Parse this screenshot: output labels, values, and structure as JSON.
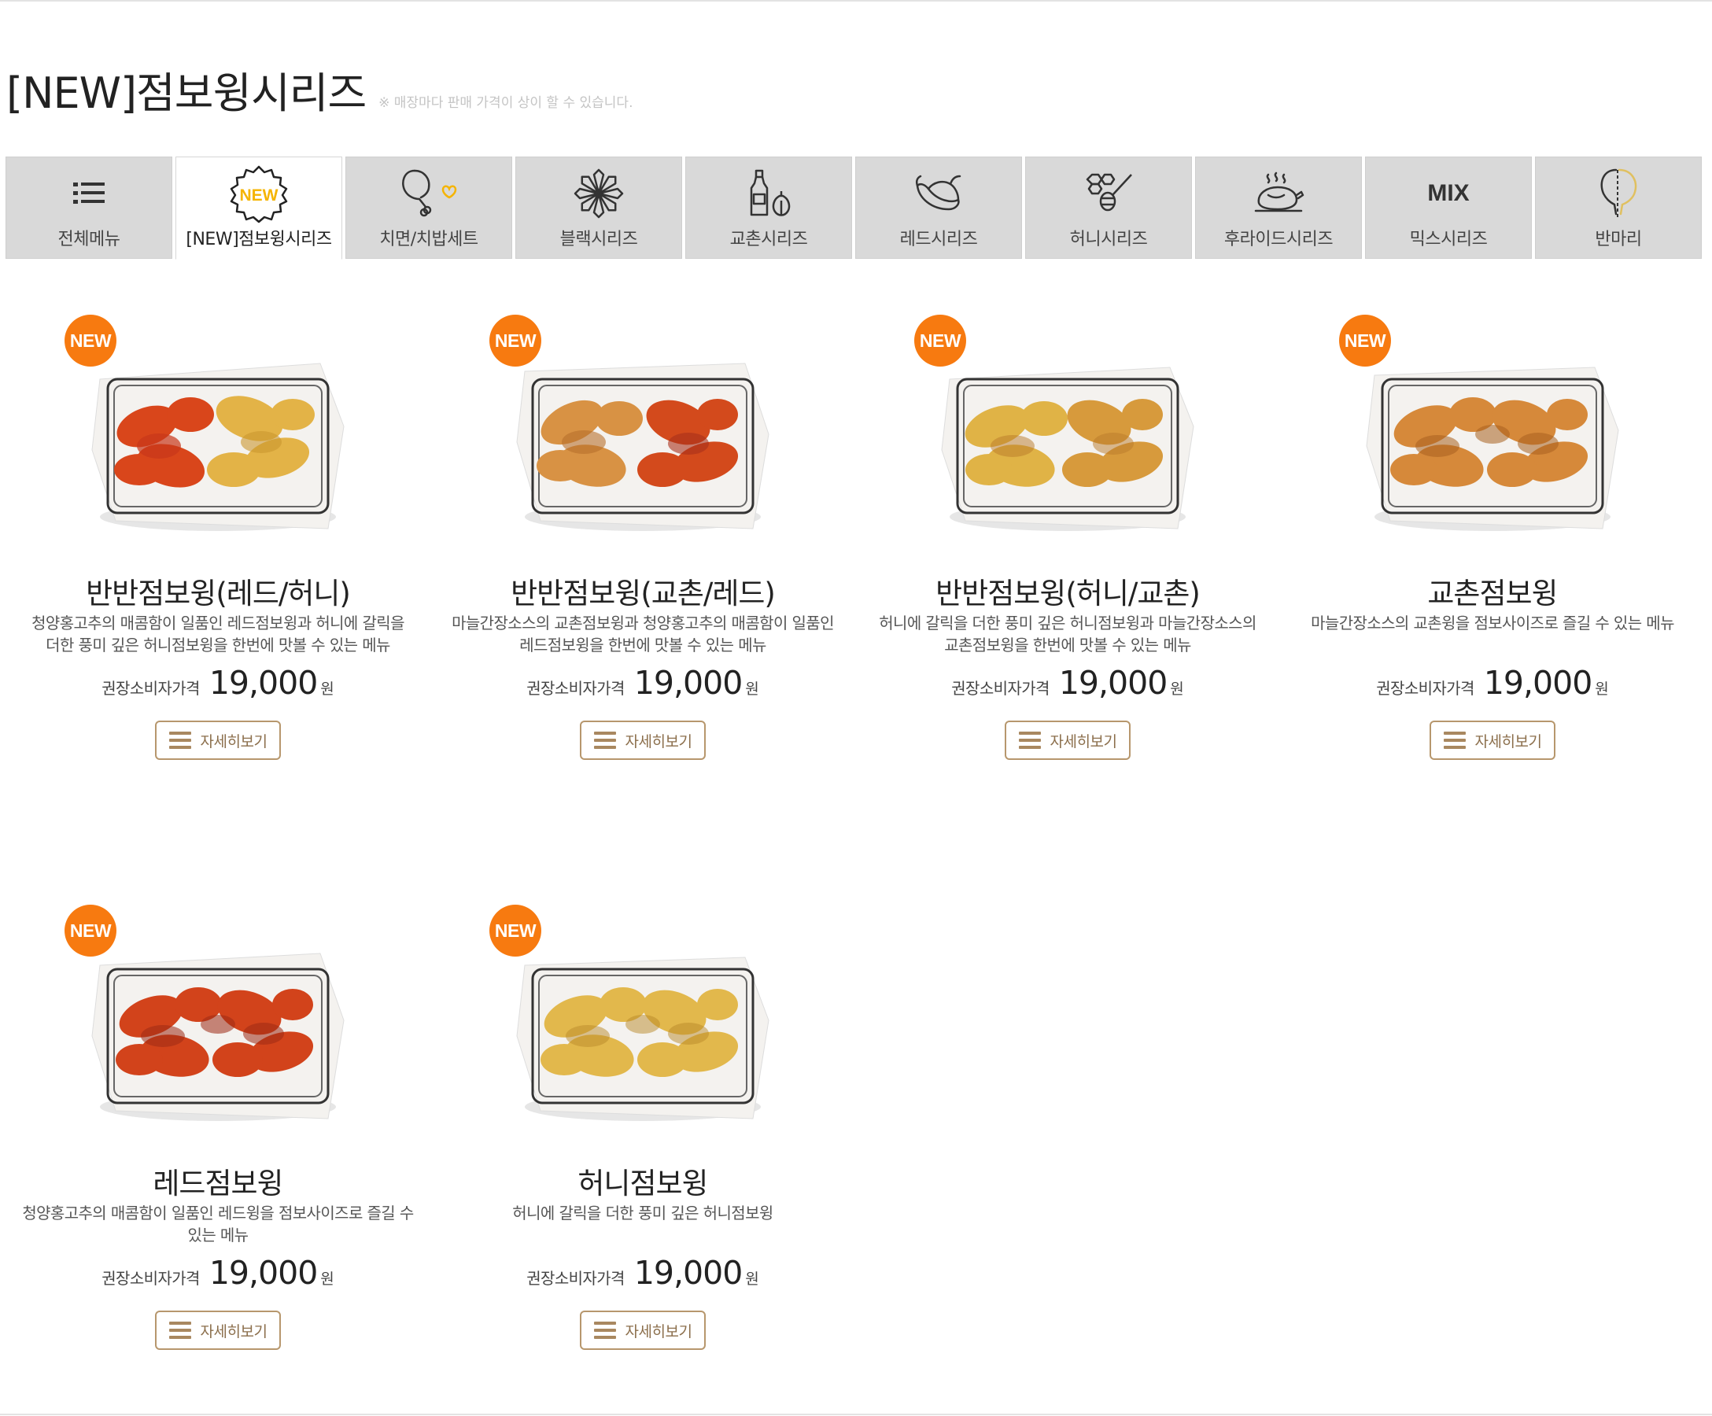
{
  "page": {
    "title": "[NEW]점보윙시리즈",
    "note": "※ 매장마다 판매 가격이 상이 할 수 있습니다."
  },
  "tabs": [
    {
      "label": "전체메뉴",
      "icon": "list-icon",
      "active": false
    },
    {
      "label": "[NEW]점보윙시리즈",
      "icon": "new-badge-icon",
      "icon_text": "NEW",
      "active": true
    },
    {
      "label": "치면/치밥세트",
      "icon": "drumstick-heart-icon",
      "active": false
    },
    {
      "label": "블랙시리즈",
      "icon": "star-anise-icon",
      "active": false
    },
    {
      "label": "교촌시리즈",
      "icon": "soy-sauce-garlic-icon",
      "active": false
    },
    {
      "label": "레드시리즈",
      "icon": "chili-pepper-icon",
      "active": false
    },
    {
      "label": "허니시리즈",
      "icon": "honeycomb-dipper-icon",
      "active": false
    },
    {
      "label": "후라이드시리즈",
      "icon": "roast-chicken-icon",
      "active": false
    },
    {
      "label": "믹스시리즈",
      "icon": "mix-text-icon",
      "icon_text": "MIX",
      "active": false
    },
    {
      "label": "반마리",
      "icon": "half-drumstick-icon",
      "active": false
    }
  ],
  "common": {
    "badge": "NEW",
    "price_label": "권장소비자가격",
    "price_unit": "원",
    "detail_label": "자세히보기"
  },
  "products": [
    {
      "name": "반반점보윙(레드/허니)",
      "desc1": "청양홍고추의 매콤함이 일품인 레드점보윙과 허니에 갈릭을",
      "desc2": "더한 풍미 깊은 허니점보윙을 한번에 맛볼 수 있는 메뉴",
      "price": "19,000",
      "flavor": "red-honey"
    },
    {
      "name": "반반점보윙(교촌/레드)",
      "desc1": "마늘간장소스의 교촌점보윙과 청양홍고추의 매콤함이 일품인",
      "desc2": "레드점보윙을 한번에 맛볼 수 있는 메뉴",
      "price": "19,000",
      "flavor": "soy-red"
    },
    {
      "name": "반반점보윙(허니/교촌)",
      "desc1": "허니에 갈릭을 더한 풍미 깊은 허니점보윙과 마늘간장소스의",
      "desc2": "교촌점보윙을 한번에 맛볼 수 있는 메뉴",
      "price": "19,000",
      "flavor": "honey-soy"
    },
    {
      "name": "교촌점보윙",
      "desc1": "마늘간장소스의 교촌윙을 점보사이즈로 즐길 수 있는 메뉴",
      "desc2": "",
      "price": "19,000",
      "flavor": "soy"
    },
    {
      "name": "레드점보윙",
      "desc1": "청양홍고추의 매콤함이 일품인 레드윙을 점보사이즈로 즐길 수",
      "desc2": "있는 메뉴",
      "price": "19,000",
      "flavor": "red"
    },
    {
      "name": "허니점보윙",
      "desc1": "허니에 갈릭을 더한 풍미 깊은 허니점보윙",
      "desc2": "",
      "price": "19,000",
      "flavor": "honey"
    }
  ],
  "colors": {
    "badge": "#f77a10",
    "tab_bg": "#d9d9d9",
    "button_border": "#b7976d",
    "button_text": "#8b6e4b"
  }
}
